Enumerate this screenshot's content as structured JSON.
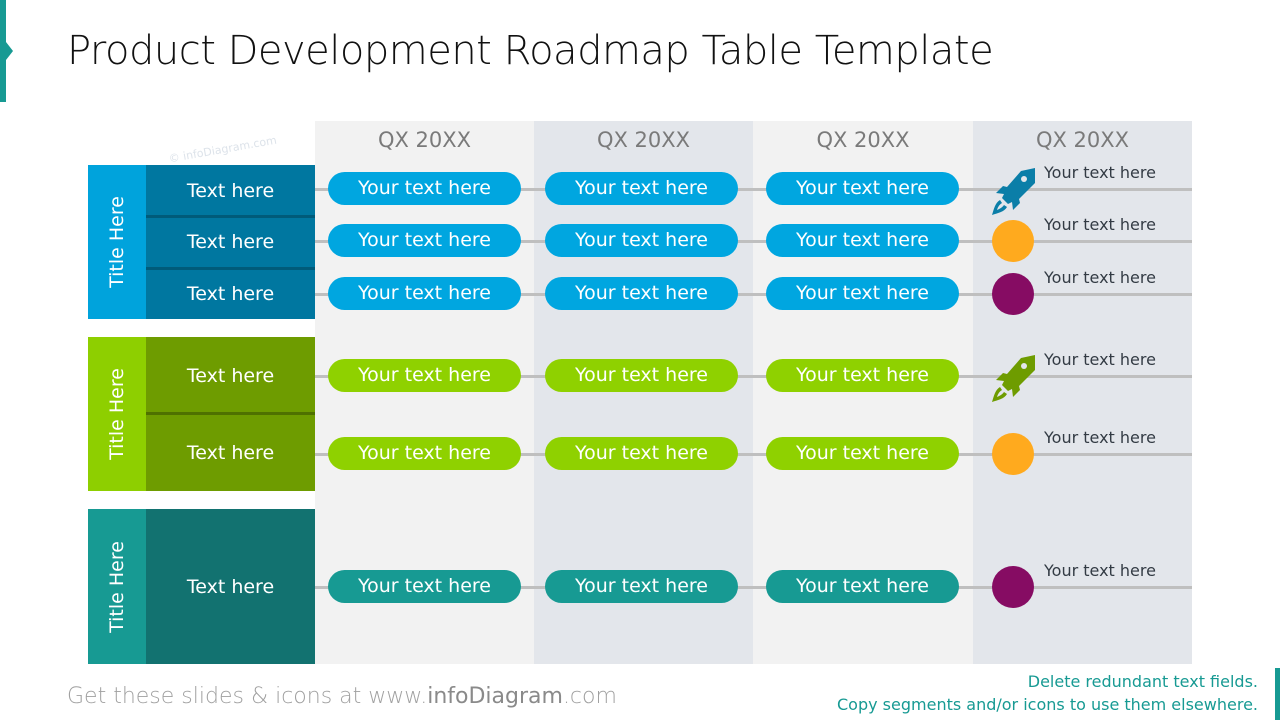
{
  "slide": {
    "title": "Product Development Roadmap Table Template",
    "watermark": "© infoDiagram.com"
  },
  "columns": [
    {
      "header": "QX 20XX",
      "bg": "#f2f2f2"
    },
    {
      "header": "QX 20XX",
      "bg": "#e3e6eb"
    },
    {
      "header": "QX 20XX",
      "bg": "#f2f2f2"
    },
    {
      "header": "QX 20XX",
      "bg": "#e3e6eb"
    }
  ],
  "groups": [
    {
      "title": "Title Here",
      "title_color": "#00a3dc",
      "label_color": "#0077a0",
      "divider_color": "#005b7a",
      "pill_color": "#00a6e0",
      "rows": [
        {
          "label": "Text here",
          "pills": [
            "Your text here",
            "Your text here",
            "Your text here"
          ],
          "milestone": {
            "type": "rocket",
            "color": "#0b7ea8",
            "text": "Your text here"
          }
        },
        {
          "label": "Text here",
          "pills": [
            "Your text here",
            "Your text here",
            "Your text here"
          ],
          "milestone": {
            "type": "dot",
            "color": "#ffaa1e",
            "text": "Your text here"
          }
        },
        {
          "label": "Text here",
          "pills": [
            "Your text here",
            "Your text here",
            "Your text here"
          ],
          "milestone": {
            "type": "dot",
            "color": "#860c63",
            "text": "Your text here"
          }
        }
      ]
    },
    {
      "title": "Title Here",
      "title_color": "#8ecf00",
      "label_color": "#6e9c00",
      "divider_color": "#4f7100",
      "pill_color": "#8fd100",
      "rows": [
        {
          "label": "Text here",
          "pills": [
            "Your text here",
            "Your text here",
            "Your text here"
          ],
          "milestone": {
            "type": "rocket",
            "color": "#6e9c00",
            "text": "Your text here"
          }
        },
        {
          "label": "Text here",
          "pills": [
            "Your text here",
            "Your text here",
            "Your text here"
          ],
          "milestone": {
            "type": "dot",
            "color": "#ffaa1e",
            "text": "Your text here"
          }
        }
      ]
    },
    {
      "title": "Title Here",
      "title_color": "#179a93",
      "label_color": "#127270",
      "divider_color": "#0e5957",
      "pill_color": "#179a93",
      "rows": [
        {
          "label": "Text here",
          "pills": [
            "Your text here",
            "Your text here",
            "Your text here"
          ],
          "milestone": {
            "type": "dot",
            "color": "#860c63",
            "text": "Your text here"
          }
        }
      ]
    }
  ],
  "footer": {
    "left_prefix": "Get these slides & icons at www.",
    "left_brand": "infoDiagram",
    "left_suffix": ".com",
    "right_line1": "Delete redundant text fields.",
    "right_line2": "Copy segments and/or icons to use them elsewhere."
  }
}
